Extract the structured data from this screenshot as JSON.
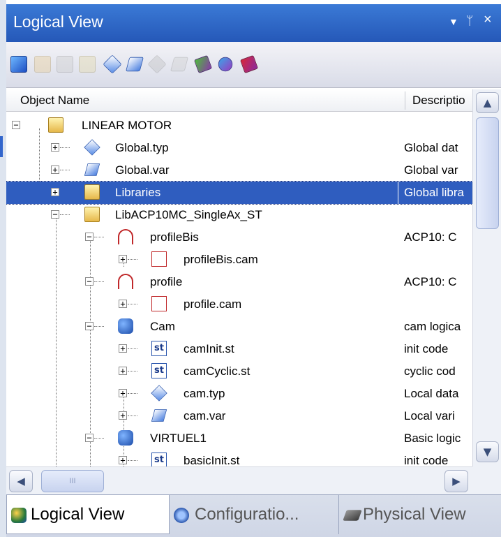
{
  "window": {
    "title": "Logical View",
    "controls": {
      "dropdown": "▼",
      "pin": "ᛘ",
      "close": "×"
    }
  },
  "toolbar": {
    "icons": [
      "new-object-icon",
      "table-icon",
      "list-icon",
      "header-file-icon",
      "datatype-icon",
      "variable-icon",
      "datatype-disabled-icon",
      "variable-disabled-icon",
      "add-library-icon",
      "refresh-library-icon",
      "remove-library-icon"
    ]
  },
  "columns": {
    "name": "Object Name",
    "description": "Descriptio"
  },
  "tree": {
    "rows": [
      {
        "label": "LINEAR MOTOR",
        "desc": "",
        "icon": "folder-open-icon",
        "expander": "−"
      },
      {
        "label": "Global.typ",
        "desc": "Global dat",
        "icon": "datatype-icon",
        "expander": "+"
      },
      {
        "label": "Global.var",
        "desc": "Global var",
        "icon": "variable-icon",
        "expander": "+"
      },
      {
        "label": "Libraries",
        "desc": "Global libra",
        "icon": "folder-icon",
        "expander": "+",
        "selected": true
      },
      {
        "label": "LibACP10MC_SingleAx_ST",
        "desc": "",
        "icon": "folder-open-icon",
        "expander": "−"
      },
      {
        "label": "profileBis",
        "desc": "ACP10: C",
        "icon": "cam-profile-icon",
        "expander": "−"
      },
      {
        "label": "profileBis.cam",
        "desc": "",
        "icon": "cam-file-icon",
        "expander": "+"
      },
      {
        "label": "profile",
        "desc": "ACP10: C",
        "icon": "cam-profile-icon",
        "expander": "−"
      },
      {
        "label": "profile.cam",
        "desc": "",
        "icon": "cam-file-icon",
        "expander": "+"
      },
      {
        "label": "Cam",
        "desc": "cam logica",
        "icon": "program-icon",
        "expander": "−"
      },
      {
        "label": "camInit.st",
        "desc": "init code",
        "icon": "st-file-icon",
        "expander": "+"
      },
      {
        "label": "camCyclic.st",
        "desc": "cyclic cod",
        "icon": "st-file-icon",
        "expander": "+"
      },
      {
        "label": "cam.typ",
        "desc": "Local data",
        "icon": "datatype-icon",
        "expander": "+"
      },
      {
        "label": "cam.var",
        "desc": "Local vari",
        "icon": "variable-icon",
        "expander": "+"
      },
      {
        "label": "VIRTUEL1",
        "desc": "Basic logic",
        "icon": "program-icon",
        "expander": "−"
      },
      {
        "label": "basicInit.st",
        "desc": "init code",
        "icon": "st-file-icon",
        "expander": "+"
      }
    ]
  },
  "scrollbars": {
    "up": "▲",
    "down": "▼",
    "left": "◀",
    "right": "▶",
    "grip": "III"
  },
  "tabs": [
    {
      "label": "Logical View",
      "icon": "logical-view-icon",
      "active": true
    },
    {
      "label": "Configuratio...",
      "icon": "configuration-icon",
      "active": false
    },
    {
      "label": "Physical View",
      "icon": "physical-view-icon",
      "active": false
    }
  ]
}
